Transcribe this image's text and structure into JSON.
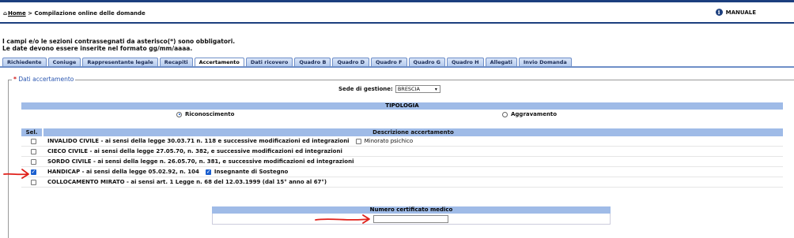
{
  "header": {
    "home_icon": "⌂",
    "home_label": "Home",
    "separator": ">",
    "page_label": "Compilazione online delle domande",
    "manual_label": "MANUALE",
    "info_icon": "i"
  },
  "notes": {
    "line1": "I campi e/o le sezioni contrassegnati da asterisco(*) sono obbligatori.",
    "line2": "Le date devono essere inserite nel formato gg/mm/aaaa."
  },
  "tabs": [
    {
      "label": "Richiedente"
    },
    {
      "label": "Coniuge"
    },
    {
      "label": "Rappresentante legale"
    },
    {
      "label": "Recapiti"
    },
    {
      "label": "Accertamento",
      "active": true
    },
    {
      "label": "Dati ricovero"
    },
    {
      "label": "Quadro B"
    },
    {
      "label": "Quadro D"
    },
    {
      "label": "Quadro F"
    },
    {
      "label": "Quadro G"
    },
    {
      "label": "Quadro H"
    },
    {
      "label": "Allegati"
    },
    {
      "label": "Invio Domanda"
    }
  ],
  "section": {
    "star": "*",
    "title": "Dati accertamento"
  },
  "sede": {
    "label": "Sede di gestione:",
    "value": "BRESCIA",
    "arrow": "▾"
  },
  "tipologia": {
    "header": "TIPOLOGIA",
    "option1": "Riconoscimento",
    "option2": "Aggravamento",
    "selected": "Riconoscimento"
  },
  "table": {
    "col_sel": "Sel.",
    "col_desc": "Descrizione accertamento",
    "rows": [
      {
        "desc": "INVALIDO CIVILE - ai sensi della legge 30.03.71 n. 118 e successive modificazioni ed integrazioni",
        "checked": false,
        "sub": "Minorato psichico",
        "sub_checked": false
      },
      {
        "desc": "CIECO CIVILE - ai sensi della legge 27.05.70, n. 382, e successive modificazioni ed integrazioni",
        "checked": false
      },
      {
        "desc": "SORDO CIVILE - ai sensi della legge n. 26.05.70, n. 381, e successive modificazioni ed integrazioni",
        "checked": false
      },
      {
        "desc": "HANDICAP - ai sensi della legge 05.02.92, n. 104",
        "checked": true,
        "sub": "Insegnante di Sostegno",
        "sub_checked": true
      },
      {
        "desc": "COLLOCAMENTO MIRATO - ai sensi art. 1 Legge n. 68 del 12.03.1999 (dal 15° anno al 67°)",
        "checked": false
      }
    ]
  },
  "certificato": {
    "label": "Numero certificato medico",
    "value": ""
  },
  "colors": {
    "header_bar": "#1c3f7e",
    "table_header": "#9fbbe7",
    "annotation": "#e0201a"
  }
}
